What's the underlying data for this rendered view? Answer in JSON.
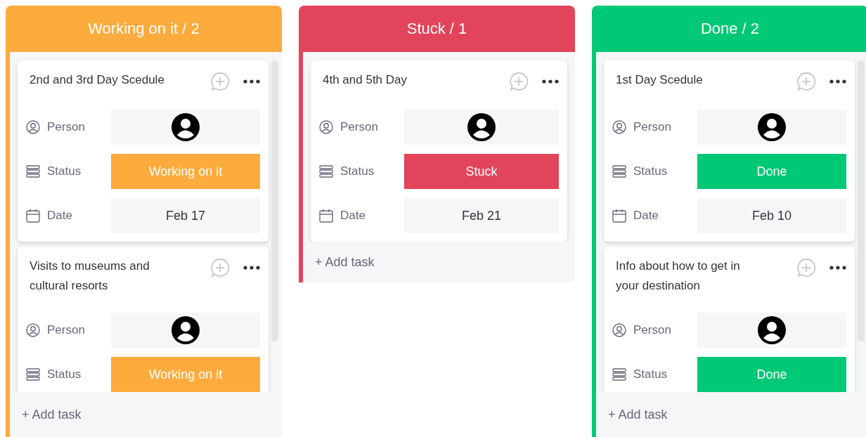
{
  "columns": [
    {
      "title": "Working on it / 2",
      "color": "#fdab3d",
      "scrollbar": true,
      "cards": [
        {
          "title": "2nd and 3rd Day Scedule",
          "fields": [
            {
              "kind": "person",
              "label": "Person"
            },
            {
              "kind": "status",
              "label": "Status",
              "value": "Working on it",
              "color": "#fdab3d"
            },
            {
              "kind": "date",
              "label": "Date",
              "value": "Feb 17"
            }
          ]
        },
        {
          "title": "Visits to museums and cultural resorts",
          "fields": [
            {
              "kind": "person",
              "label": "Person"
            },
            {
              "kind": "status",
              "label": "Status",
              "value": "Working on it",
              "color": "#fdab3d"
            }
          ]
        }
      ],
      "add_task": "+ Add task"
    },
    {
      "title": "Stuck / 1",
      "color": "#e2445c",
      "scrollbar": false,
      "cards": [
        {
          "title": "4th and 5th Day",
          "fields": [
            {
              "kind": "person",
              "label": "Person"
            },
            {
              "kind": "status",
              "label": "Status",
              "value": "Stuck",
              "color": "#e2445c"
            },
            {
              "kind": "date",
              "label": "Date",
              "value": "Feb 21"
            }
          ]
        }
      ],
      "add_task": "+ Add task"
    },
    {
      "title": "Done / 2",
      "color": "#00c875",
      "scrollbar": true,
      "cards": [
        {
          "title": "1st Day Scedule",
          "fields": [
            {
              "kind": "person",
              "label": "Person"
            },
            {
              "kind": "status",
              "label": "Status",
              "value": "Done",
              "color": "#00c875"
            },
            {
              "kind": "date",
              "label": "Date",
              "value": "Feb 10"
            }
          ]
        },
        {
          "title": "Info about how to get in your destination",
          "fields": [
            {
              "kind": "person",
              "label": "Person"
            },
            {
              "kind": "status",
              "label": "Status",
              "value": "Done",
              "color": "#00c875"
            }
          ]
        }
      ],
      "add_task": "+ Add task"
    }
  ]
}
